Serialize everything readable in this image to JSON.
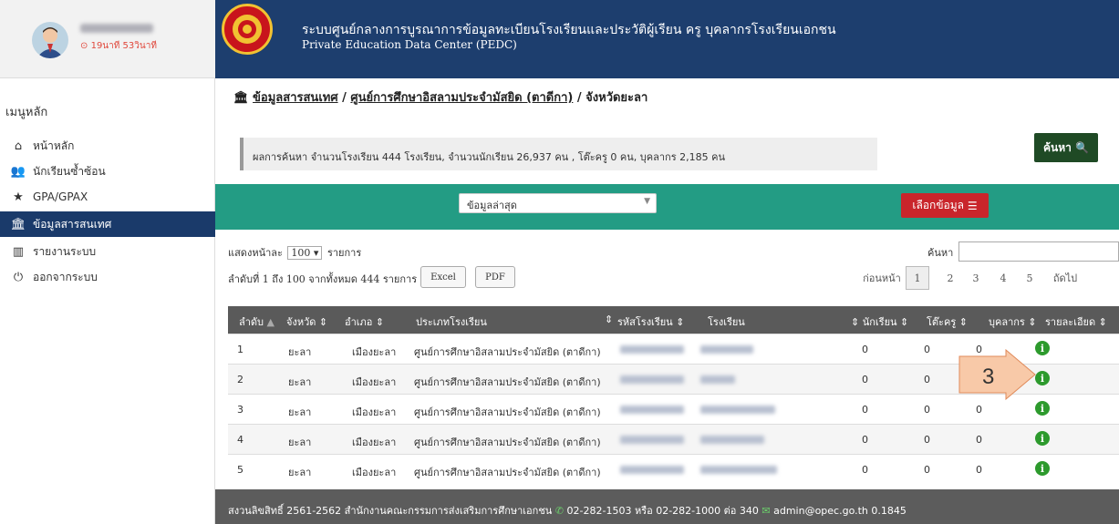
{
  "profile": {
    "time": "19นาที 53วินาที"
  },
  "menu": {
    "title": "เมนูหลัก",
    "items": [
      {
        "label": "หน้าหลัก",
        "icon": "home-icon"
      },
      {
        "label": "นักเรียนซ้ำซ้อน",
        "icon": "users-icon"
      },
      {
        "label": "GPA/GPAX",
        "icon": "star-icon"
      },
      {
        "label": "ข้อมูลสารสนเทศ",
        "icon": "institution-icon"
      },
      {
        "label": "รายงานระบบ",
        "icon": "bar-chart-icon"
      },
      {
        "label": "ออกจากระบบ",
        "icon": "power-icon"
      }
    ],
    "active_index": 3
  },
  "header": {
    "title": "ระบบศูนย์กลางการบูรณาการข้อมูลทะเบียนโรงเรียนและประวัติผู้เรียน ครู บุคลากรโรงเรียนเอกชน",
    "subtitle": "Private Education Data Center (PEDC)"
  },
  "breadcrumb": {
    "part1": "ข้อมูลสารสนเทศ",
    "sep": " / ",
    "part2": "ศูนย์การศึกษาอิสลามประจำมัสยิด (ตาดีกา)",
    "part3": " / จังหวัดยะลา"
  },
  "result_text": "ผลการค้นหา จำนวนโรงเรียน 444 โรงเรียน, จำนวนนักเรียน 26,937 คน , โต๊ะครู 0 คน, บุคลากร 2,185 คน",
  "search_button": "ค้นหา",
  "filter": {
    "selected": "ข้อมูลล่าสุด",
    "pick_button": "เลือกข้อมูล"
  },
  "table_controls": {
    "show_prefix": "แสดงหน้าละ",
    "page_length": "100",
    "show_suffix": "รายการ",
    "info": "ลำดับที่ 1 ถึง 100 จากทั้งหมด 444 รายการ",
    "excel": "Excel",
    "pdf": "PDF",
    "search_label": "ค้นหา",
    "search_value": "",
    "prev": "ก่อนหน้า",
    "pages": [
      "1",
      "2",
      "3",
      "4",
      "5"
    ],
    "next": "ถัดไป"
  },
  "columns": [
    "ลำดับ",
    "จังหวัด",
    "อำเภอ",
    "ประเภทโรงเรียน",
    "รหัสโรงเรียน",
    "โรงเรียน",
    "นักเรียน",
    "โต๊ะครู",
    "บุคลากร",
    "รายละเอียด"
  ],
  "rows": [
    {
      "no": "1",
      "province": "ยะลา",
      "district": "เมืองยะลา",
      "type": "ศูนย์การศึกษาอิสลามประจำมัสยิด (ตาดีกา)",
      "students": "0",
      "teachers": "0",
      "staff": "0"
    },
    {
      "no": "2",
      "province": "ยะลา",
      "district": "เมืองยะลา",
      "type": "ศูนย์การศึกษาอิสลามประจำมัสยิด (ตาดีกา)",
      "students": "0",
      "teachers": "0",
      "staff": ""
    },
    {
      "no": "3",
      "province": "ยะลา",
      "district": "เมืองยะลา",
      "type": "ศูนย์การศึกษาอิสลามประจำมัสยิด (ตาดีกา)",
      "students": "0",
      "teachers": "0",
      "staff": "0"
    },
    {
      "no": "4",
      "province": "ยะลา",
      "district": "เมืองยะลา",
      "type": "ศูนย์การศึกษาอิสลามประจำมัสยิด (ตาดีกา)",
      "students": "0",
      "teachers": "0",
      "staff": "0"
    },
    {
      "no": "5",
      "province": "ยะลา",
      "district": "เมืองยะลา",
      "type": "ศูนย์การศึกษาอิสลามประจำมัสยิด (ตาดีกา)",
      "students": "0",
      "teachers": "0",
      "staff": "0"
    }
  ],
  "callout": {
    "number": "3",
    "color": "#f8c9a8"
  },
  "footer": {
    "copyright": "สงวนลิขสิทธิ์ 2561-2562 สำนักงานคณะกรรมการส่งเสริมการศึกษาเอกชน",
    "phone": "02-282-1503 หรือ 02-282-1000 ต่อ 340",
    "email": "admin@opec.go.th 0.1845"
  },
  "colors": {
    "header": "#1d3e6e",
    "filter_bar": "#239c84",
    "pick_button": "#c9252b",
    "search_button": "#1f4a25",
    "info_icon": "#2d9a2d"
  }
}
